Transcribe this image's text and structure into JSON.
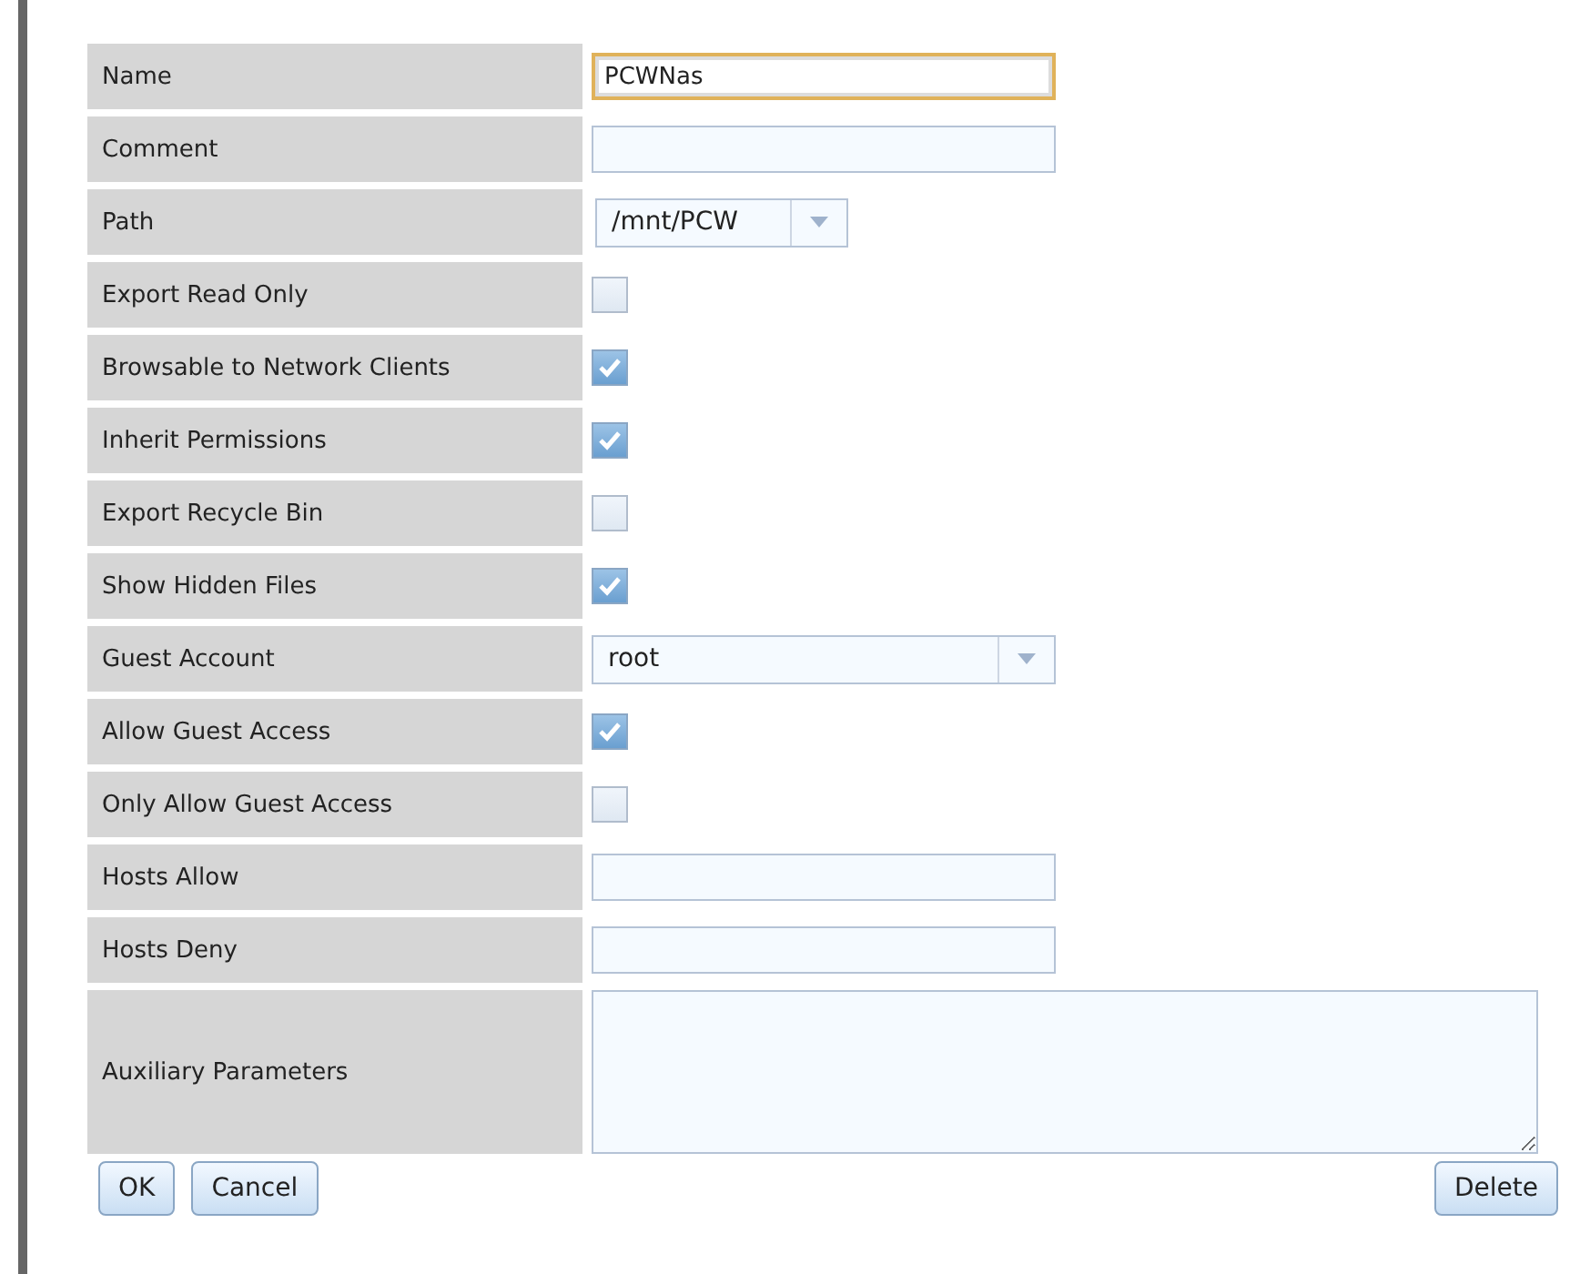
{
  "rows": [
    {
      "label": "Name",
      "kind": "text",
      "value": "PCWNas",
      "focused": true
    },
    {
      "label": "Comment",
      "kind": "text",
      "value": "",
      "focused": false
    },
    {
      "label": "Path",
      "kind": "combo",
      "value": "/mnt/PCW"
    },
    {
      "label": "Export Read Only",
      "kind": "checkbox",
      "checked": false
    },
    {
      "label": "Browsable to Network Clients",
      "kind": "checkbox",
      "checked": true
    },
    {
      "label": "Inherit Permissions",
      "kind": "checkbox",
      "checked": true
    },
    {
      "label": "Export Recycle Bin",
      "kind": "checkbox",
      "checked": false
    },
    {
      "label": "Show Hidden Files",
      "kind": "checkbox",
      "checked": true
    },
    {
      "label": "Guest Account",
      "kind": "select",
      "value": "root"
    },
    {
      "label": "Allow Guest Access",
      "kind": "checkbox",
      "checked": true
    },
    {
      "label": "Only Allow Guest Access",
      "kind": "checkbox",
      "checked": false
    },
    {
      "label": "Hosts Allow",
      "kind": "text",
      "value": "",
      "focused": false
    },
    {
      "label": "Hosts Deny",
      "kind": "text",
      "value": "",
      "focused": false
    },
    {
      "label": "Auxiliary Parameters",
      "kind": "textarea",
      "value": ""
    }
  ],
  "buttons_left": [
    "OK",
    "Cancel"
  ],
  "buttons_right": [
    "Delete"
  ]
}
